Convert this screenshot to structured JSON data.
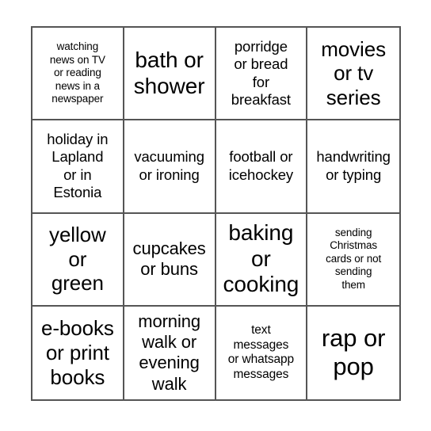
{
  "card": {
    "type": "bingo-card",
    "rows": 4,
    "columns": 4,
    "border_color": "#555555",
    "background_color": "#ffffff",
    "text_color": "#000000",
    "cells": [
      {
        "text": "watching\nnews on TV\nor reading\nnews in a\nnewspaper",
        "size": "fs-xs"
      },
      {
        "text": "bath or\nshower",
        "size": "fs-xxl"
      },
      {
        "text": "porridge\nor bread\nfor\nbreakfast",
        "size": "fs-m"
      },
      {
        "text": "movies\nor tv\nseries",
        "size": "fs-xl"
      },
      {
        "text": "holiday in\nLapland\nor in\nEstonia",
        "size": "fs-m"
      },
      {
        "text": "vacuuming\nor ironing",
        "size": "fs-m"
      },
      {
        "text": "football or\nicehockey",
        "size": "fs-m"
      },
      {
        "text": "handwriting\nor typing",
        "size": "fs-m"
      },
      {
        "text": "yellow\nor\ngreen",
        "size": "fs-xl"
      },
      {
        "text": "cupcakes\nor buns",
        "size": "fs-l"
      },
      {
        "text": "baking\nor\ncooking",
        "size": "fs-xxl"
      },
      {
        "text": "sending\nChristmas\ncards or not\nsending\nthem",
        "size": "fs-xs"
      },
      {
        "text": "e-books\nor print\nbooks",
        "size": "fs-xl"
      },
      {
        "text": "morning\nwalk or\nevening\nwalk",
        "size": "fs-l"
      },
      {
        "text": "text\nmessages\nor whatsapp\nmessages",
        "size": "fs-s"
      },
      {
        "text": "rap or\npop",
        "size": "fs-xxxl"
      }
    ]
  }
}
